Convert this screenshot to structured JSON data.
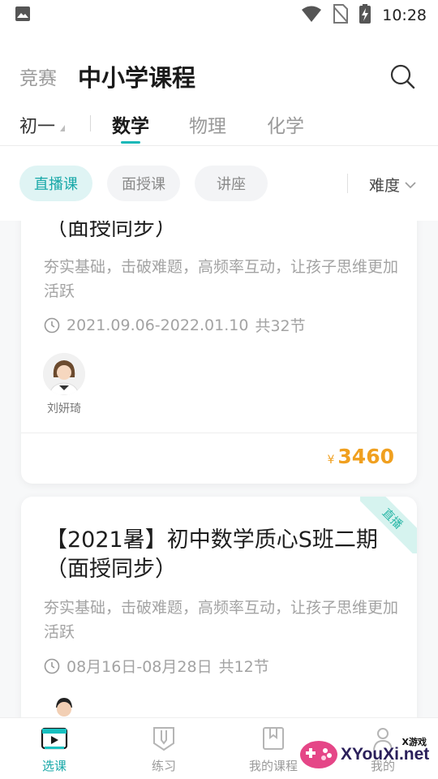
{
  "status_bar": {
    "time": "10:28"
  },
  "header": {
    "tab_inactive": "竞赛",
    "title": "中小学课程"
  },
  "grade_selector": {
    "label": "初一"
  },
  "subjects": [
    {
      "label": "数学",
      "active": true
    },
    {
      "label": "物理",
      "active": false
    },
    {
      "label": "化学",
      "active": false
    }
  ],
  "filters": [
    {
      "label": "直播课",
      "active": true
    },
    {
      "label": "面授课",
      "active": false
    },
    {
      "label": "讲座",
      "active": false
    }
  ],
  "difficulty": {
    "label": "难度"
  },
  "courses": [
    {
      "title_visible": "（面授同步）",
      "description": "夯实基础，击破难题，高频率互动，让孩子思维更加活跃",
      "date_range": "2021.09.06-2022.01.10",
      "lessons": "共32节",
      "teacher": "刘妍琦",
      "price_symbol": "¥",
      "price": "3460"
    },
    {
      "badge": "直播",
      "title": "【2021暑】初中数学质心S班二期（面授同步）",
      "description": "夯实基础，击破难题，高频率互动，让孩子思维更加活跃",
      "date_range": "08月16日-08月28日",
      "lessons": "共12节"
    }
  ],
  "bottom_nav": [
    {
      "label": "选课",
      "icon": "play-board-icon",
      "active": true
    },
    {
      "label": "练习",
      "icon": "pencil-shield-icon",
      "active": false
    },
    {
      "label": "我的课程",
      "icon": "bookmark-book-icon",
      "active": false
    },
    {
      "label": "我的",
      "icon": "person-icon",
      "active": false
    }
  ],
  "watermark": {
    "small": "X游戏",
    "main": "XYouXi.net"
  },
  "colors": {
    "accent": "#18a8a8",
    "price": "#f0a020",
    "muted": "#a3a3a3"
  }
}
